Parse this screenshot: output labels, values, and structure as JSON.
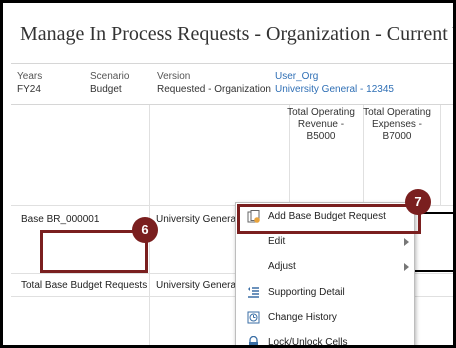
{
  "page_title": "Manage In Process Requests - Organization - Current Year",
  "pov": [
    {
      "label": "Years",
      "value": "FY24"
    },
    {
      "label": "Scenario",
      "value": "Budget"
    },
    {
      "label": "Version",
      "value": "Requested - Organization"
    },
    {
      "label": "User_Org",
      "value": "University General - 12345"
    }
  ],
  "columns": [
    "Total Operating Revenue - B5000",
    "Total Operating Expenses - B7000"
  ],
  "rows": [
    {
      "name": "Base BR_000001",
      "org": "University General"
    },
    {
      "name": "Total Base Budget Requests",
      "org": "University General"
    }
  ],
  "callouts": {
    "step6": "6",
    "step7": "7"
  },
  "context_menu": [
    {
      "label": "Add Base Budget Request",
      "icon": "add-document-icon",
      "submenu": false
    },
    {
      "label": "Edit",
      "icon": "",
      "submenu": true
    },
    {
      "label": "Adjust",
      "icon": "",
      "submenu": true
    },
    {
      "label": "Supporting Detail",
      "icon": "supporting-detail-icon",
      "submenu": false
    },
    {
      "label": "Change History",
      "icon": "history-icon",
      "submenu": false
    },
    {
      "label": "Lock/Unlock Cells",
      "icon": "lock-icon",
      "submenu": false
    }
  ],
  "colors": {
    "callout": "#7a1f1f",
    "link": "#2f6fb5"
  }
}
